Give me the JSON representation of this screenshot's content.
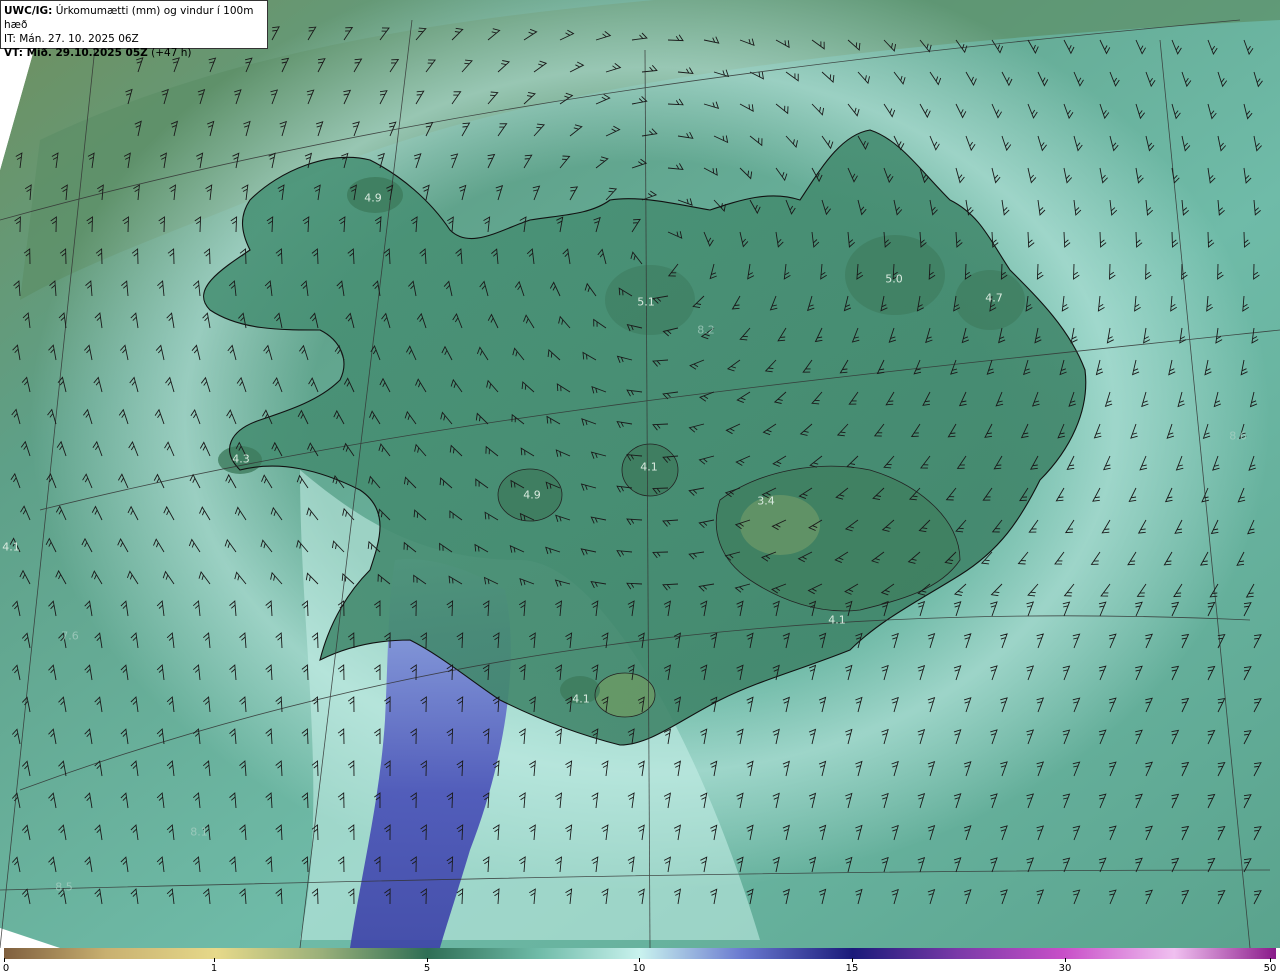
{
  "header": {
    "model_prefix": "UWC/IG:",
    "title_text": " Úrkomumætti (mm) og vindur í 100m hæð",
    "init_time": "IT: Mán. 27. 10. 2025 06Z",
    "valid_prefix": "VT: Mið. 29.10.2025 05Z",
    "valid_suffix": " (+47 h)"
  },
  "peak_labels": [
    {
      "text": "4.9",
      "faint": false
    },
    {
      "text": "5.1",
      "faint": false
    },
    {
      "text": "8.2",
      "faint": true
    },
    {
      "text": "5.0",
      "faint": false
    },
    {
      "text": "4.7",
      "faint": false
    },
    {
      "text": "4.3",
      "faint": false
    },
    {
      "text": "4.1",
      "faint": false
    },
    {
      "text": "4.9",
      "faint": false
    },
    {
      "text": "3.4",
      "faint": false
    },
    {
      "text": "4.1",
      "faint": false
    },
    {
      "text": "4.1",
      "faint": false
    },
    {
      "text": "4.1",
      "faint": false
    },
    {
      "text": "7.6",
      "faint": true
    },
    {
      "text": "8.1",
      "faint": true
    },
    {
      "text": "8.5",
      "faint": true
    },
    {
      "text": "8.6",
      "faint": true
    }
  ],
  "colorbar": {
    "ticks": [
      "0",
      "1",
      "5",
      "10",
      "15",
      "30",
      "50"
    ],
    "colors": {
      "c0": "#7f5f3e",
      "c1": "#e6d98a",
      "c5": "#2e6e55",
      "c10": "#c9f2ee",
      "c15": "#1a1a7a",
      "c30": "#c84fc8",
      "c50": "#8a1a8a"
    }
  },
  "map_colors": {
    "ocean_base": "#6fbba8",
    "ocean_dark": "#4e8f7a",
    "nw_band": "#6a8f5a",
    "light_band": "#c8f0ea",
    "blue_band": "#4a52b8",
    "land": "#4f9a7a",
    "land_dark": "#3a7a5e",
    "glacier": "#7aa06a",
    "coast": "#111111",
    "grid": "#333333",
    "barb": "#1a1a1a"
  }
}
